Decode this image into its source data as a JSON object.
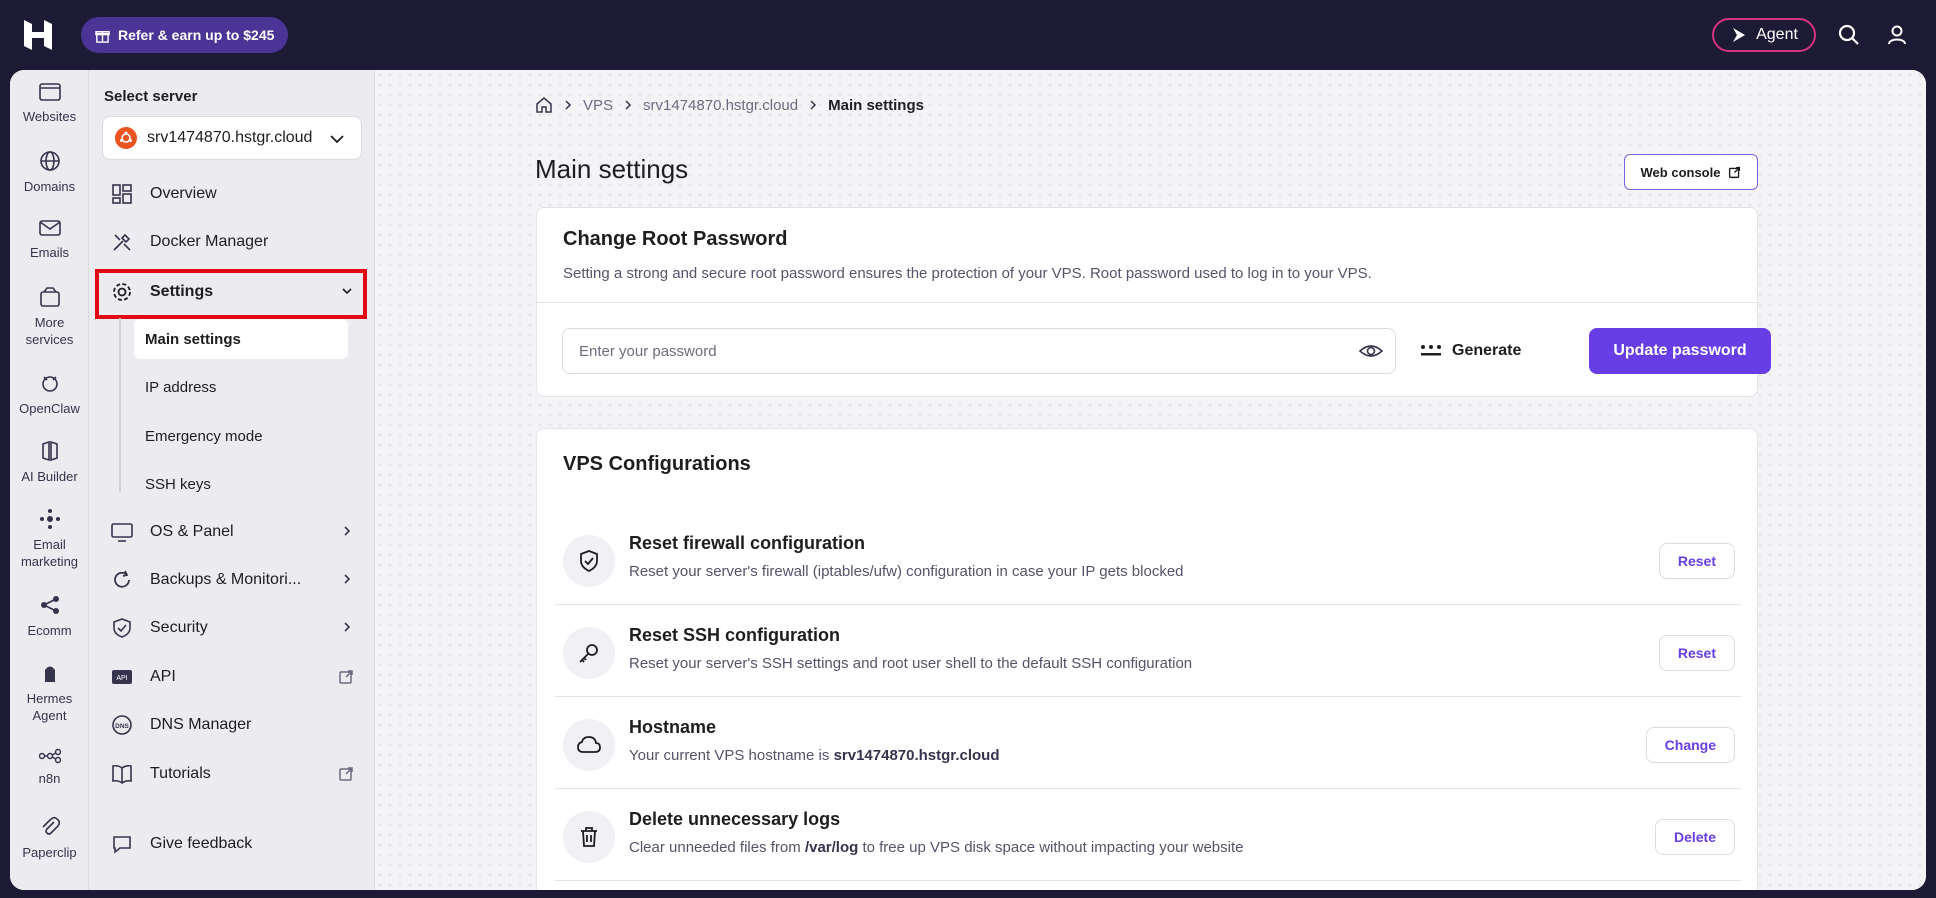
{
  "topbar": {
    "refer_label": "Refer & earn up to $245",
    "agent_label": "Agent"
  },
  "rail": [
    {
      "label": "Websites",
      "icon": "websites-icon"
    },
    {
      "label": "Domains",
      "icon": "globe-icon"
    },
    {
      "label": "Emails",
      "icon": "mail-icon"
    },
    {
      "label": "More services",
      "icon": "box-icon"
    },
    {
      "label": "OpenClaw",
      "icon": "openclaw-icon"
    },
    {
      "label": "AI Builder",
      "icon": "ai-builder-icon"
    },
    {
      "label": "Email marketing",
      "icon": "email-marketing-icon"
    },
    {
      "label": "Ecomm",
      "icon": "ecomm-icon"
    },
    {
      "label": "Hermes Agent",
      "icon": "hermes-icon"
    },
    {
      "label": "n8n",
      "icon": "n8n-icon"
    },
    {
      "label": "Paperclip",
      "icon": "paperclip-icon"
    }
  ],
  "sidebar": {
    "select_label": "Select server",
    "server": "srv1474870.hstgr.cloud",
    "items": [
      {
        "label": "Overview"
      },
      {
        "label": "Docker Manager"
      },
      {
        "label": "Settings"
      },
      {
        "label": "OS & Panel"
      },
      {
        "label": "Backups & Monitori..."
      },
      {
        "label": "Security"
      },
      {
        "label": "API"
      },
      {
        "label": "DNS Manager"
      },
      {
        "label": "Tutorials"
      },
      {
        "label": "Give feedback"
      }
    ],
    "sub_items": [
      {
        "label": "Main settings"
      },
      {
        "label": "IP address"
      },
      {
        "label": "Emergency mode"
      },
      {
        "label": "SSH keys"
      }
    ]
  },
  "breadcrumb": {
    "items": [
      "VPS",
      "srv1474870.hstgr.cloud"
    ],
    "current": "Main settings"
  },
  "page": {
    "title": "Main settings",
    "web_console": "Web console"
  },
  "root_password": {
    "title": "Change Root Password",
    "description": "Setting a strong and secure root password ensures the protection of your VPS. Root password used to log in to your VPS.",
    "placeholder": "Enter your password",
    "generate": "Generate",
    "update": "Update password"
  },
  "vps_config": {
    "title": "VPS Configurations",
    "rows": [
      {
        "title": "Reset firewall configuration",
        "desc": "Reset your server's firewall (iptables/ufw) configuration in case your IP gets blocked",
        "button": "Reset"
      },
      {
        "title": "Reset SSH configuration",
        "desc": "Reset your server's SSH settings and root user shell to the default SSH configuration",
        "button": "Reset"
      },
      {
        "title": "Hostname",
        "desc_prefix": "Your current VPS hostname is ",
        "desc_bold": "srv1474870.hstgr.cloud",
        "button": "Change"
      },
      {
        "title": "Delete unnecessary logs",
        "desc_prefix": "Clear unneeded files from ",
        "desc_bold": "/var/log",
        "desc_suffix": " to free up VPS disk space without impacting your website",
        "button": "Delete"
      }
    ]
  },
  "colors": {
    "primary": "#673de6",
    "topbar": "#1d1a35",
    "highlight": "#e30613"
  }
}
